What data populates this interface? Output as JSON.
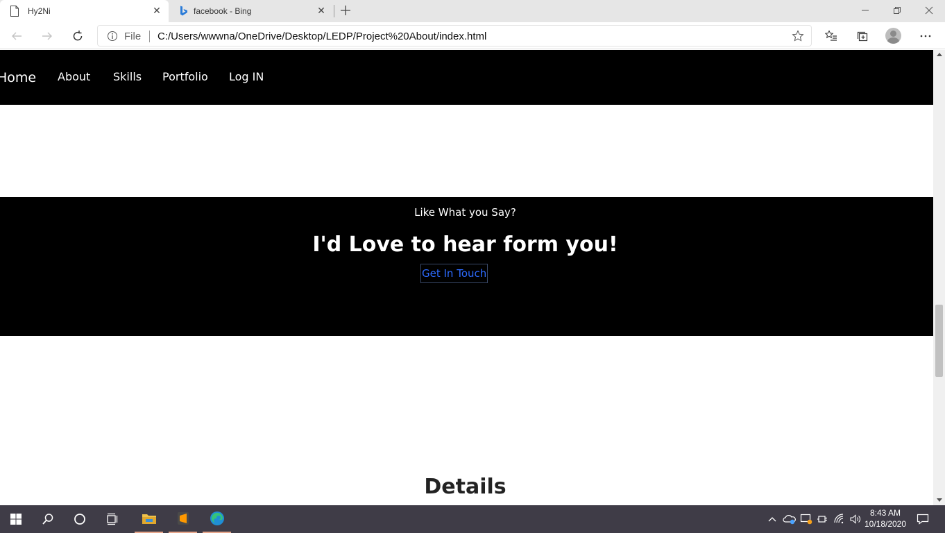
{
  "browser": {
    "tabs": [
      {
        "title": "Hy2Ni",
        "active": true,
        "icon": "page-icon"
      },
      {
        "title": "facebook - Bing",
        "active": false,
        "icon": "bing-icon"
      }
    ],
    "address": {
      "scheme_label": "File",
      "url": "C:/Users/wwwna/OneDrive/Desktop/LEDP/Project%20About/index.html"
    }
  },
  "page": {
    "nav": [
      "Home",
      "About",
      "Skills",
      "Portfolio",
      "Log IN"
    ],
    "cta": {
      "subtitle": "Like What you Say?",
      "heading": "I'd Love to hear form you!",
      "button": "Get In Touch"
    },
    "details_heading": "Details"
  },
  "taskbar": {
    "time": "8:43 AM",
    "date": "10/18/2020"
  },
  "colors": {
    "nav_bg": "#000000",
    "cta_link": "#2d6bff",
    "taskbar_bg": "#3f3c47"
  }
}
